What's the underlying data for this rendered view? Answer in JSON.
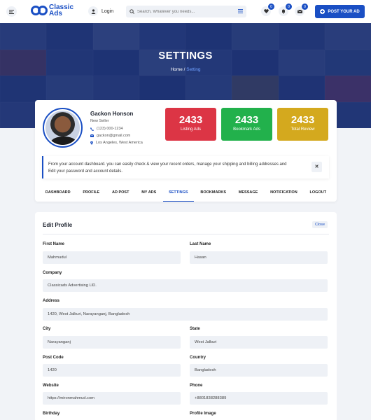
{
  "header": {
    "logo_text_1": "Classic",
    "logo_text_2": "Ads",
    "login_label": "Login",
    "search_placeholder": "Search, Whatever you needs...",
    "wishlist_count": "0",
    "notification_count": "0",
    "message_count": "0",
    "post_button_label": "POST YOUR AD"
  },
  "hero": {
    "title": "SETTINGS",
    "breadcrumb_home": "Home",
    "breadcrumb_separator": "/",
    "breadcrumb_current": "Setting"
  },
  "profile": {
    "name": "Gackon Honson",
    "role": "New Seller",
    "phone": "(123) 000-1234",
    "email": "gackon@gmail.com",
    "location": "Los Angeles, West America"
  },
  "stats": [
    {
      "value": "2433",
      "label": "Listing Ads",
      "color": "#dc3545"
    },
    {
      "value": "2433",
      "label": "Bookmark Ads",
      "color": "#22b14c"
    },
    {
      "value": "2433",
      "label": "Total Review",
      "color": "#d4a91e"
    }
  ],
  "alert": {
    "text": "From your account dashboard. you can easily check & view your recent orders, manage your shipping and billing addresses and Edit your password and account details.",
    "close_symbol": "✕"
  },
  "tabs": [
    "DASHBOARD",
    "PROFILE",
    "AD POST",
    "MY ADS",
    "SETTINGS",
    "BOOKMARKS",
    "MESSAGE",
    "NOTIFICATION",
    "LOGOUT"
  ],
  "edit_profile": {
    "title": "Edit Profile",
    "close_label": "Close",
    "first_name_label": "First Name",
    "first_name_value": "Mahmudul",
    "last_name_label": "Last Name",
    "last_name_value": "Hasan",
    "company_label": "Company",
    "company_value": "Classicads Advertising LlD.",
    "address_label": "Address",
    "address_value": "1420, West Jalkuri, Narayanganj, Bangladesh",
    "city_label": "City",
    "city_value": "Narayanganj",
    "state_label": "State",
    "state_value": "West Jalkuri",
    "post_code_label": "Post Code",
    "post_code_value": "1420",
    "country_label": "Country",
    "country_value": "Bangladesh",
    "website_label": "Website",
    "website_value": "https://mironmahmud.com",
    "phone_label": "Phone",
    "phone_value": "+8801838288389",
    "birthday_label": "Birthday",
    "profile_image_label": "Profile Image"
  },
  "colors": {
    "brand": "#1a4fc4",
    "hero_overlay": "#14286e"
  }
}
